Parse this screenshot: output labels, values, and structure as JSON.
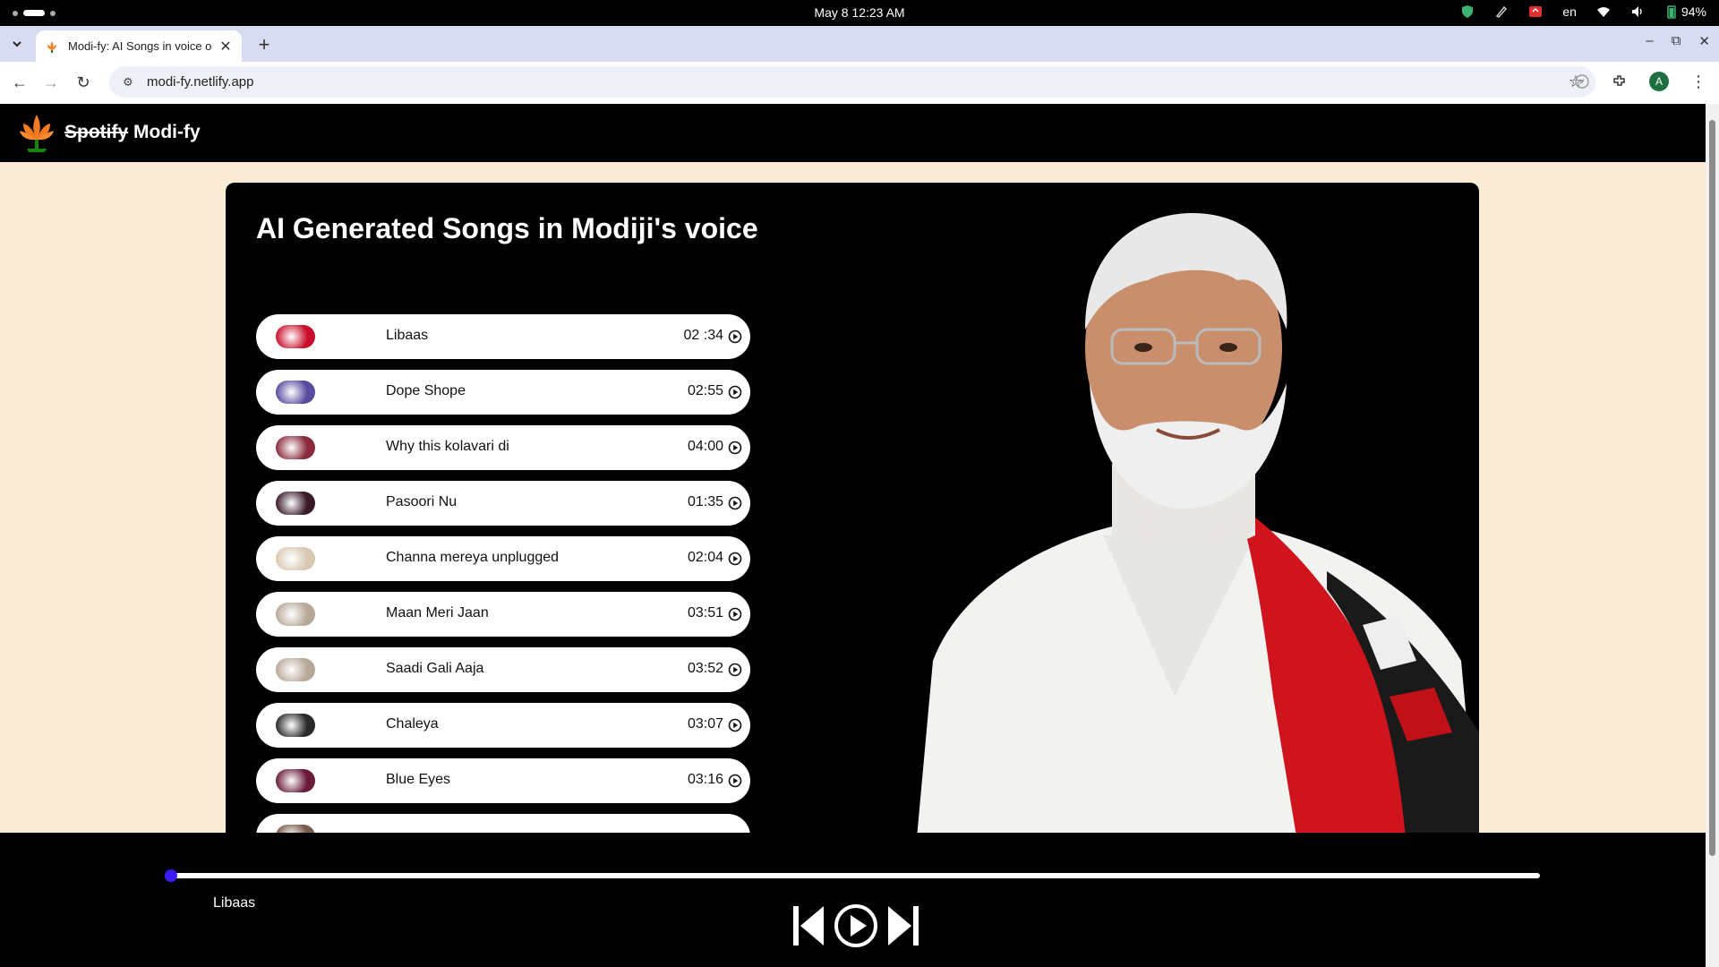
{
  "os": {
    "datetime": "May 8  12:23 AM",
    "language": "en",
    "battery": "94%"
  },
  "browser": {
    "tab_title": "Modi-fy: AI Songs in voice o",
    "new_tab": "+",
    "url": "modi-fy.netlify.app",
    "profile_initial": "A"
  },
  "site": {
    "brand_strike": "Spotify",
    "brand_name": "Modi-fy",
    "heading": "AI Generated Songs in Modiji's voice"
  },
  "songs": [
    {
      "name": "Libaas",
      "duration": "02 :34",
      "thumb_color": "#c8102e"
    },
    {
      "name": "Dope Shope",
      "duration": "02:55",
      "thumb_color": "#5a4aa0"
    },
    {
      "name": "Why this kolavari di",
      "duration": "04:00",
      "thumb_color": "#8a2a3a"
    },
    {
      "name": "Pasoori Nu",
      "duration": "01:35",
      "thumb_color": "#3a1a2a"
    },
    {
      "name": "Channa mereya unplugged",
      "duration": "02:04",
      "thumb_color": "#d8c8b0"
    },
    {
      "name": "Maan Meri Jaan",
      "duration": "03:51",
      "thumb_color": "#b8a898"
    },
    {
      "name": "Saadi Gali Aaja",
      "duration": "03:52",
      "thumb_color": "#b8a898"
    },
    {
      "name": "Chaleya",
      "duration": "03:07",
      "thumb_color": "#2a2a2a"
    },
    {
      "name": "Blue Eyes",
      "duration": "03:16",
      "thumb_color": "#6a1a3a"
    },
    {
      "name": "",
      "duration": "",
      "thumb_color": "#7a5a4a"
    }
  ],
  "player": {
    "now_playing": "Libaas",
    "progress": 0.0,
    "accent": "#4a2bff"
  },
  "colors": {
    "page_bg": "#f9ebd6",
    "header_bg": "#000000",
    "card_bg": "#000000"
  }
}
